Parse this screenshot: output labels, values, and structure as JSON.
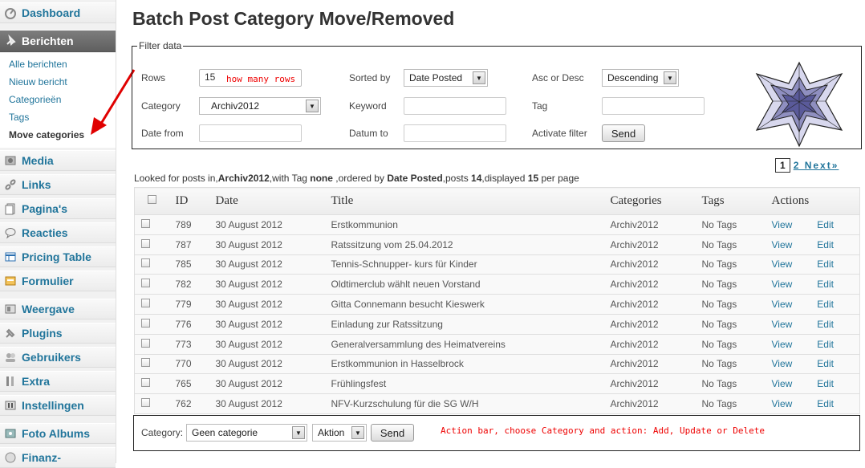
{
  "sidebar": {
    "menu": [
      {
        "label": "Dashboard",
        "icon": "dashboard-icon"
      },
      {
        "label": "Berichten",
        "icon": "pin-icon"
      },
      {
        "label": "Media",
        "icon": "media-icon"
      },
      {
        "label": "Links",
        "icon": "link-icon"
      },
      {
        "label": "Pagina's",
        "icon": "pages-icon"
      },
      {
        "label": "Reacties",
        "icon": "comments-icon"
      },
      {
        "label": "Pricing Table",
        "icon": "table-icon"
      },
      {
        "label": "Formulier",
        "icon": "form-icon"
      },
      {
        "label": "Weergave",
        "icon": "appearance-icon"
      },
      {
        "label": "Plugins",
        "icon": "plugin-icon"
      },
      {
        "label": "Gebruikers",
        "icon": "users-icon"
      },
      {
        "label": "Extra",
        "icon": "tools-icon"
      },
      {
        "label": "Instellingen",
        "icon": "settings-icon"
      },
      {
        "label": "Foto Albums",
        "icon": "photo-icon"
      },
      {
        "label": "Finanz-",
        "icon": "finance-icon"
      }
    ],
    "submenu": [
      "Alle berichten",
      "Nieuw bericht",
      "Categorieën",
      "Tags",
      "Move categories"
    ]
  },
  "page_title": "Batch Post Category Move/Removed",
  "filter": {
    "legend": "Filter data",
    "rows_label": "Rows",
    "rows_value": "15",
    "rows_annotation": "how many rows",
    "category_label": "Category",
    "category_value": "Archiv2012",
    "date_from_label": "Date from",
    "sorted_by_label": "Sorted by",
    "sorted_by_value": "Date Posted",
    "keyword_label": "Keyword",
    "datum_to_label": "Datum to",
    "order_label": "Asc or Desc",
    "order_value": "Descending",
    "tag_label": "Tag",
    "activate_label": "Activate filter",
    "send_label": "Send"
  },
  "pagination": {
    "current": "1",
    "next_pages": "2 Next»"
  },
  "summary": {
    "prefix": "Looked for posts in,",
    "category": "Archiv2012",
    "tag_text": ",with Tag ",
    "tag": "none",
    "order_text": " ,ordered by ",
    "order": "Date Posted",
    "posts_text": ",posts ",
    "posts": "14",
    "displayed_text": ",displayed ",
    "displayed": "15",
    "suffix": " per page"
  },
  "table": {
    "headers": {
      "id": "ID",
      "date": "Date",
      "title": "Title",
      "categories": "Categories",
      "tags": "Tags",
      "actions": "Actions"
    },
    "view_label": "View",
    "edit_label": "Edit",
    "rows": [
      {
        "id": "789",
        "date": "30 August 2012",
        "title": "Erstkommunion",
        "category": "Archiv2012",
        "tags": "No Tags"
      },
      {
        "id": "787",
        "date": "30 August 2012",
        "title": "Ratssitzung vom 25.04.2012",
        "category": "Archiv2012",
        "tags": "No Tags"
      },
      {
        "id": "785",
        "date": "30 August 2012",
        "title": "Tennis-Schnupper- kurs für Kinder",
        "category": "Archiv2012",
        "tags": "No Tags"
      },
      {
        "id": "782",
        "date": "30 August 2012",
        "title": "Oldtimerclub wählt neuen Vorstand",
        "category": "Archiv2012",
        "tags": "No Tags"
      },
      {
        "id": "779",
        "date": "30 August 2012",
        "title": "Gitta Connemann besucht Kieswerk",
        "category": "Archiv2012",
        "tags": "No Tags"
      },
      {
        "id": "776",
        "date": "30 August 2012",
        "title": "Einladung zur Ratssitzung",
        "category": "Archiv2012",
        "tags": "No Tags"
      },
      {
        "id": "773",
        "date": "30 August 2012",
        "title": "Generalversammlung des Heimatvereins",
        "category": "Archiv2012",
        "tags": "No Tags"
      },
      {
        "id": "770",
        "date": "30 August 2012",
        "title": "Erstkommunion in Hasselbrock",
        "category": "Archiv2012",
        "tags": "No Tags"
      },
      {
        "id": "765",
        "date": "30 August 2012",
        "title": "Frühlingsfest",
        "category": "Archiv2012",
        "tags": "No Tags"
      },
      {
        "id": "762",
        "date": "30 August 2012",
        "title": "NFV-Kurzschulung für die SG W/H",
        "category": "Archiv2012",
        "tags": "No Tags"
      }
    ]
  },
  "action_bar": {
    "category_label": "Category:",
    "category_value": "Geen categorie",
    "action_value": "Aktion",
    "send_label": "Send",
    "annotation": "Action bar, choose Category and action: Add, Update or Delete"
  },
  "colors": {
    "link": "#21759b",
    "annotation": "#e00000"
  }
}
